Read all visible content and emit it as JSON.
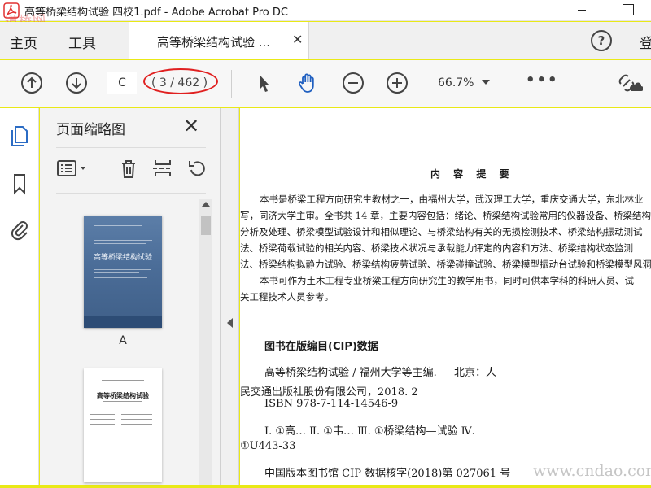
{
  "window": {
    "title": "高等桥梁结构试验 四校1.pdf - Adobe Acrobat Pro DC"
  },
  "watermarks": {
    "top_left": "道桥网",
    "bottom_right": "www.cndao.com"
  },
  "tabs": {
    "home": "主页",
    "tools": "工具",
    "document": "高等桥梁结构试验 ...",
    "help": "?",
    "cut_off": "登"
  },
  "toolbar": {
    "page_input": "C",
    "page_count": "( 3 / 462 )",
    "zoom": "66.7%",
    "more": "•••"
  },
  "thumbnail_panel": {
    "title": "页面缩略图",
    "thumbnails": [
      {
        "label": "A",
        "caption": "高等桥梁结构试验"
      },
      {
        "label": "",
        "caption": "高等桥梁结构试验"
      }
    ]
  },
  "document": {
    "heading": "内 容 提 要",
    "paragraph_lines": [
      "本书是桥梁工程方向研究生教材之一，由福州大学，武汉理工大学，重庆交通大学，东北林业",
      "写，同济大学主审。全书共 14 章，主要内容包括：绪论、桥梁结构试验常用的仪器设备、桥梁结构",
      "分析及处理、桥梁模型试验设计和相似理论、与桥梁结构有关的无损检测技术、桥梁结构振动测试",
      "法、桥梁荷载试验的相关内容、桥梁技术状况与承载能力评定的内容和方法、桥梁结构状态监测",
      "法、桥梁结构拟静力试验、桥梁结构疲劳试验、桥梁碰撞试验、桥梁模型振动台试验和桥梁模型风洞",
      "本书可作为土木工程专业桥梁工程方向研究生的教学用书，同时可供本学科的科研人员、试",
      "关工程技术人员参考。"
    ],
    "cip_title": "图书在版编目(CIP)数据",
    "cip_lines": [
      "高等桥梁结构试验 / 福州大学等主编. — 北京：人",
      "民交通出版社股份有限公司，2018. 2",
      "ISBN 978-7-114-14546-9",
      "Ⅰ. ①高…   Ⅱ. ①韦…   Ⅲ. ①桥梁结构—试验   Ⅳ.",
      "①U443-33",
      "中国版本图书馆 CIP 数据核字(2018)第 027061 号"
    ]
  },
  "colors": {
    "frame": "#e9e916",
    "highlight_ellipse": "#e02020",
    "cover_blue": "#4b6d98",
    "rail_icon_blue": "#2b6cc4"
  }
}
